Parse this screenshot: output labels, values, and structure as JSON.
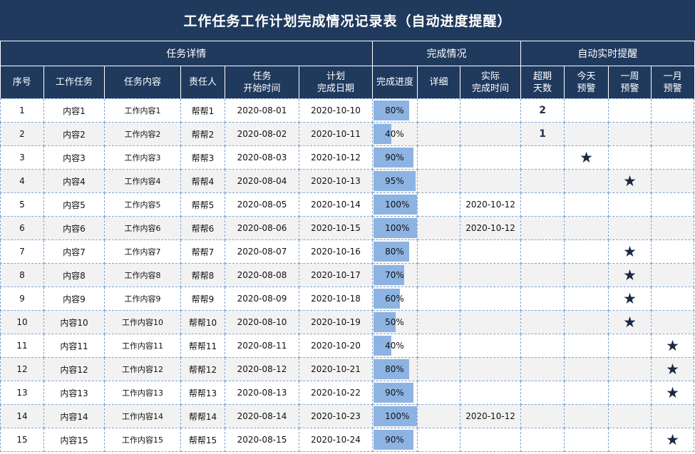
{
  "title": "工作任务工作计划完成情况记录表（自动进度提醒）",
  "colors": {
    "header_bg": "#203a5e",
    "bar": "#8db3e2",
    "grid": "#7fa4cf",
    "alt_row": "#f2f2f2"
  },
  "groups": [
    "任务详情",
    "完成情况",
    "自动实时提醒"
  ],
  "headers": {
    "seq": "序号",
    "task": "工作任务",
    "content": "任务内容",
    "owner": "责任人",
    "start_l1": "任务",
    "start_l2": "开始时间",
    "plan_l1": "计划",
    "plan_l2": "完成日期",
    "progress": "完成进度",
    "detail": "详细",
    "actual_l1": "实际",
    "actual_l2": "完成时间",
    "over_l1": "超期",
    "over_l2": "天数",
    "today_l1": "今天",
    "today_l2": "预警",
    "week_l1": "一周",
    "week_l2": "预警",
    "month_l1": "一月",
    "month_l2": "预警"
  },
  "star_glyph": "★",
  "rows": [
    {
      "seq": "1",
      "task": "内容1",
      "content": "工作内容1",
      "owner": "帮帮1",
      "start": "2020-08-01",
      "plan": "2020-10-10",
      "progress": "80%",
      "progress_value": 0.8,
      "detail": "",
      "actual": "",
      "overdue": "2",
      "today": false,
      "week": false,
      "month": false
    },
    {
      "seq": "2",
      "task": "内容2",
      "content": "工作内容2",
      "owner": "帮帮2",
      "start": "2020-08-02",
      "plan": "2020-10-11",
      "progress": "40%",
      "progress_value": 0.4,
      "detail": "",
      "actual": "",
      "overdue": "1",
      "today": false,
      "week": false,
      "month": false
    },
    {
      "seq": "3",
      "task": "内容3",
      "content": "工作内容3",
      "owner": "帮帮3",
      "start": "2020-08-03",
      "plan": "2020-10-12",
      "progress": "90%",
      "progress_value": 0.9,
      "detail": "",
      "actual": "",
      "overdue": "",
      "today": true,
      "week": false,
      "month": false
    },
    {
      "seq": "4",
      "task": "内容4",
      "content": "工作内容4",
      "owner": "帮帮4",
      "start": "2020-08-04",
      "plan": "2020-10-13",
      "progress": "95%",
      "progress_value": 0.95,
      "detail": "",
      "actual": "",
      "overdue": "",
      "today": false,
      "week": true,
      "month": false
    },
    {
      "seq": "5",
      "task": "内容5",
      "content": "工作内容5",
      "owner": "帮帮5",
      "start": "2020-08-05",
      "plan": "2020-10-14",
      "progress": "100%",
      "progress_value": 1.0,
      "detail": "",
      "actual": "2020-10-12",
      "overdue": "",
      "today": false,
      "week": false,
      "month": false
    },
    {
      "seq": "6",
      "task": "内容6",
      "content": "工作内容6",
      "owner": "帮帮6",
      "start": "2020-08-06",
      "plan": "2020-10-15",
      "progress": "100%",
      "progress_value": 1.0,
      "detail": "",
      "actual": "2020-10-12",
      "overdue": "",
      "today": false,
      "week": false,
      "month": false
    },
    {
      "seq": "7",
      "task": "内容7",
      "content": "工作内容7",
      "owner": "帮帮7",
      "start": "2020-08-07",
      "plan": "2020-10-16",
      "progress": "80%",
      "progress_value": 0.8,
      "detail": "",
      "actual": "",
      "overdue": "",
      "today": false,
      "week": true,
      "month": false
    },
    {
      "seq": "8",
      "task": "内容8",
      "content": "工作内容8",
      "owner": "帮帮8",
      "start": "2020-08-08",
      "plan": "2020-10-17",
      "progress": "70%",
      "progress_value": 0.7,
      "detail": "",
      "actual": "",
      "overdue": "",
      "today": false,
      "week": true,
      "month": false
    },
    {
      "seq": "9",
      "task": "内容9",
      "content": "工作内容9",
      "owner": "帮帮9",
      "start": "2020-08-09",
      "plan": "2020-10-18",
      "progress": "60%",
      "progress_value": 0.6,
      "detail": "",
      "actual": "",
      "overdue": "",
      "today": false,
      "week": true,
      "month": false
    },
    {
      "seq": "10",
      "task": "内容10",
      "content": "工作内容10",
      "owner": "帮帮10",
      "start": "2020-08-10",
      "plan": "2020-10-19",
      "progress": "50%",
      "progress_value": 0.5,
      "detail": "",
      "actual": "",
      "overdue": "",
      "today": false,
      "week": true,
      "month": false
    },
    {
      "seq": "11",
      "task": "内容11",
      "content": "工作内容11",
      "owner": "帮帮11",
      "start": "2020-08-11",
      "plan": "2020-10-20",
      "progress": "40%",
      "progress_value": 0.4,
      "detail": "",
      "actual": "",
      "overdue": "",
      "today": false,
      "week": false,
      "month": true
    },
    {
      "seq": "12",
      "task": "内容12",
      "content": "工作内容12",
      "owner": "帮帮12",
      "start": "2020-08-12",
      "plan": "2020-10-21",
      "progress": "80%",
      "progress_value": 0.8,
      "detail": "",
      "actual": "",
      "overdue": "",
      "today": false,
      "week": false,
      "month": true
    },
    {
      "seq": "13",
      "task": "内容13",
      "content": "工作内容13",
      "owner": "帮帮13",
      "start": "2020-08-13",
      "plan": "2020-10-22",
      "progress": "90%",
      "progress_value": 0.9,
      "detail": "",
      "actual": "",
      "overdue": "",
      "today": false,
      "week": false,
      "month": true
    },
    {
      "seq": "14",
      "task": "内容14",
      "content": "工作内容14",
      "owner": "帮帮14",
      "start": "2020-08-14",
      "plan": "2020-10-23",
      "progress": "100%",
      "progress_value": 1.0,
      "detail": "",
      "actual": "2020-10-12",
      "overdue": "",
      "today": false,
      "week": false,
      "month": false
    },
    {
      "seq": "15",
      "task": "内容15",
      "content": "工作内容15",
      "owner": "帮帮15",
      "start": "2020-08-15",
      "plan": "2020-10-24",
      "progress": "90%",
      "progress_value": 0.9,
      "detail": "",
      "actual": "",
      "overdue": "",
      "today": false,
      "week": false,
      "month": true
    }
  ]
}
